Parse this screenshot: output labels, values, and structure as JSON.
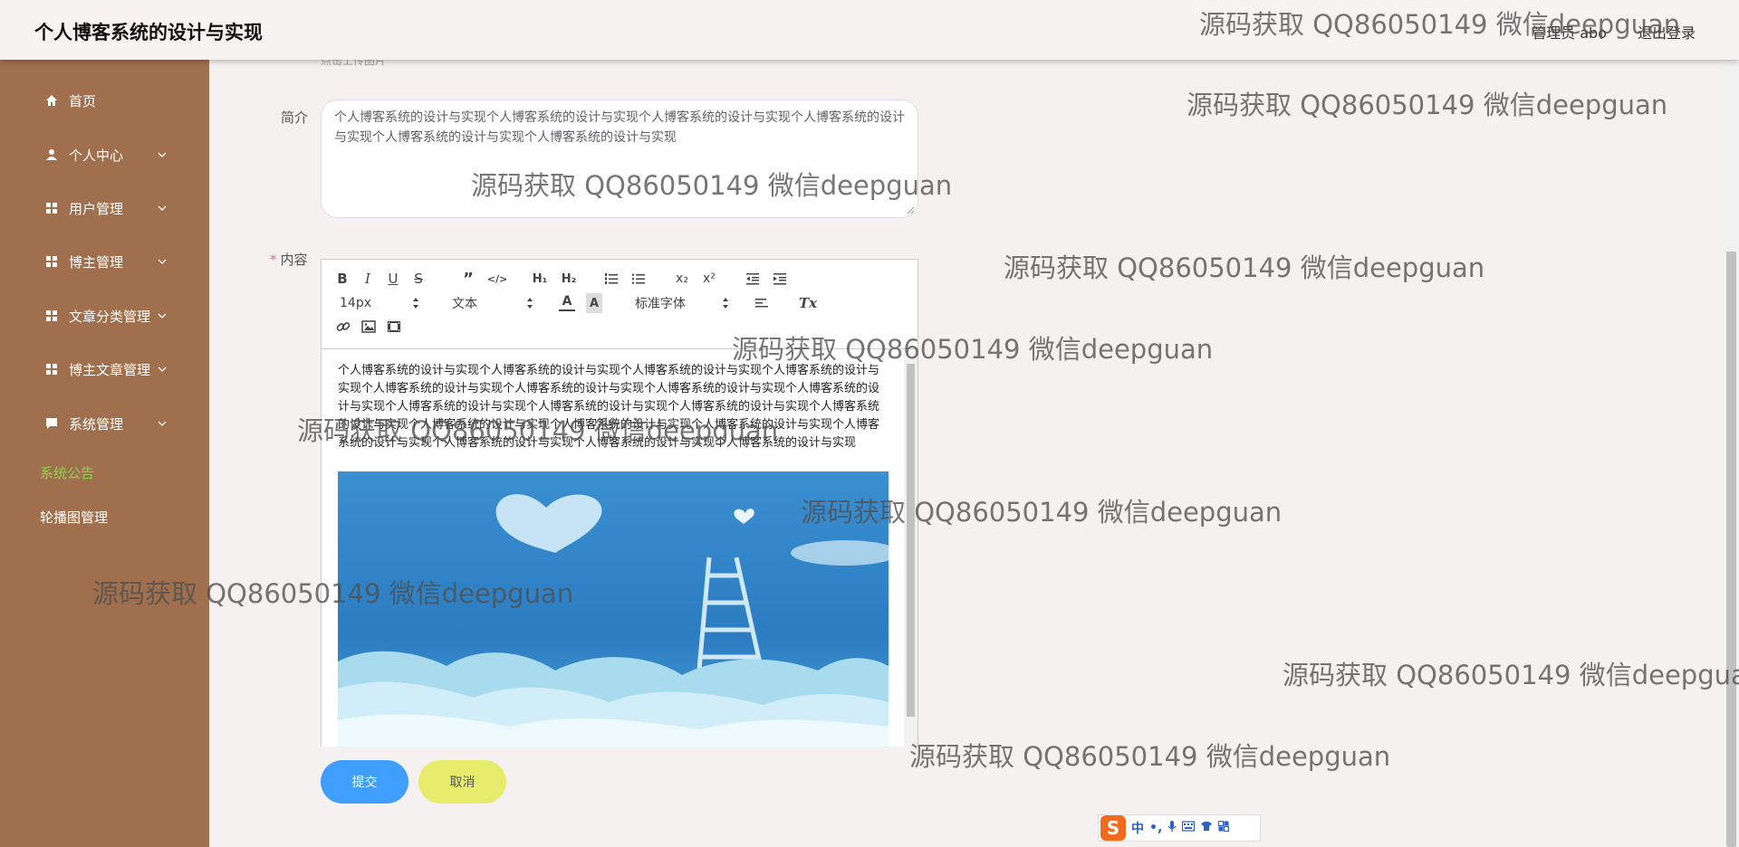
{
  "header": {
    "app_title": "个人博客系统的设计与实现",
    "admin_label": "管理员 abo",
    "logout_label": "退出登录"
  },
  "sidebar": {
    "items": [
      {
        "label": "首页",
        "icon": "home-icon"
      },
      {
        "label": "个人中心",
        "icon": "user-icon"
      },
      {
        "label": "用户管理",
        "icon": "grid-icon"
      },
      {
        "label": "博主管理",
        "icon": "grid-icon"
      },
      {
        "label": "文章分类管理",
        "icon": "grid-icon"
      },
      {
        "label": "博主文章管理",
        "icon": "grid-icon"
      },
      {
        "label": "系统管理",
        "icon": "chat-icon"
      },
      {
        "label": "系统公告",
        "icon": ""
      },
      {
        "label": "轮播图管理",
        "icon": ""
      }
    ],
    "active_color": "#8fd14f",
    "background": "#a0704e"
  },
  "form": {
    "upload_hint": "点击上传图片",
    "summary_label": "简介",
    "summary_value": "个人博客系统的设计与实现个人博客系统的设计与实现个人博客系统的设计与实现个人博客系统的设计与实现个人博客系统的设计与实现个人博客系统的设计与实现",
    "content_label": "内容",
    "required_mark": "*",
    "editor": {
      "font_size": "14px",
      "paragraph_type": "文本",
      "font_family": "标准字体",
      "content_text": "个人博客系统的设计与实现个人博客系统的设计与实现个人博客系统的设计与实现个人博客系统的设计与实现个人博客系统的设计与实现个人博客系统的设计与实现个人博客系统的设计与实现个人博客系统的设计与实现个人博客系统的设计与实现个人博客系统的设计与实现个人博客系统的设计与实现个人博客系统的设计与实现个人博客系统的设计与实现个人博客系统的设计与实现个人博客系统的设计与实现个人博客系统的设计与实现个人博客系统的设计与实现个人博客系统的设计与实现个人博客系统的设计与实现",
      "image": "sky-clouds-heart-ladder"
    },
    "submit_label": "提交",
    "cancel_label": "取消"
  },
  "watermark_text": "源码获取 QQ86050149 微信deepguan",
  "ime": {
    "logo": "S",
    "mode": "中"
  }
}
